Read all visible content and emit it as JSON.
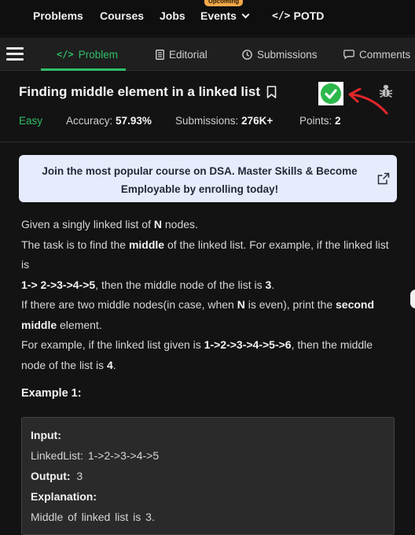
{
  "topnav": {
    "items": [
      "Problems",
      "Courses",
      "Jobs",
      "Events"
    ],
    "events_badge": "Upcoming",
    "potd_label": "POTD",
    "potd_icon": "code-slash-icon"
  },
  "tabs": [
    {
      "label": "Problem",
      "icon": "code-icon",
      "active": true
    },
    {
      "label": "Editorial",
      "icon": "document-icon",
      "active": false
    },
    {
      "label": "Submissions",
      "icon": "clock-icon",
      "active": false
    },
    {
      "label": "Comments",
      "icon": "chat-bubble-icon",
      "active": false
    }
  ],
  "problem": {
    "title": "Finding middle element in a linked list",
    "difficulty": "Easy",
    "accuracy_label": "Accuracy:",
    "accuracy_value": "57.93%",
    "submissions_label": "Submissions:",
    "submissions_value": "276K+",
    "points_label": "Points:",
    "points_value": "2",
    "status_icon": "check-circle-icon",
    "status_color": "#2cb84b"
  },
  "banner": {
    "text": "Join the most popular course on DSA. Master Skills & Become Employable by enrolling today!",
    "icon": "external-link-icon",
    "background": "#e6ecfb"
  },
  "description": {
    "line1_a": "Given a singly linked list of ",
    "line1_b": "N",
    "line1_c": " nodes.",
    "line2_a": "The task is to find the ",
    "line2_b": "middle",
    "line2_c": " of the linked list. For example, if the linked list is",
    "line3_b": "1-> 2->3->4->5",
    "line3_c": ", then the middle node of the list is ",
    "line3_d": "3",
    "line3_e": ".",
    "line4_a": "If there are two middle nodes(in case, when ",
    "line4_b": "N",
    "line4_c": " is even), print the ",
    "line4_d": "second middle",
    "line4_e": " element.",
    "line5_a": "For example, if the linked list given is ",
    "line5_b": "1->2->3->4->5->6",
    "line5_c": ", then the middle node of the list is ",
    "line5_d": "4",
    "line5_e": "."
  },
  "example": {
    "title": "Example 1:",
    "input_label": "Input:",
    "input_value": "LinkedList:  1->2->3->4->5",
    "output_label": "Output:",
    "output_value": "3",
    "explanation_label": "Explanation:",
    "explanation_value": "Middle  of  linked  list  is  3."
  },
  "colors": {
    "accent_green": "#2fbf67",
    "annotation_red": "#e0262b",
    "background": "#131313"
  }
}
